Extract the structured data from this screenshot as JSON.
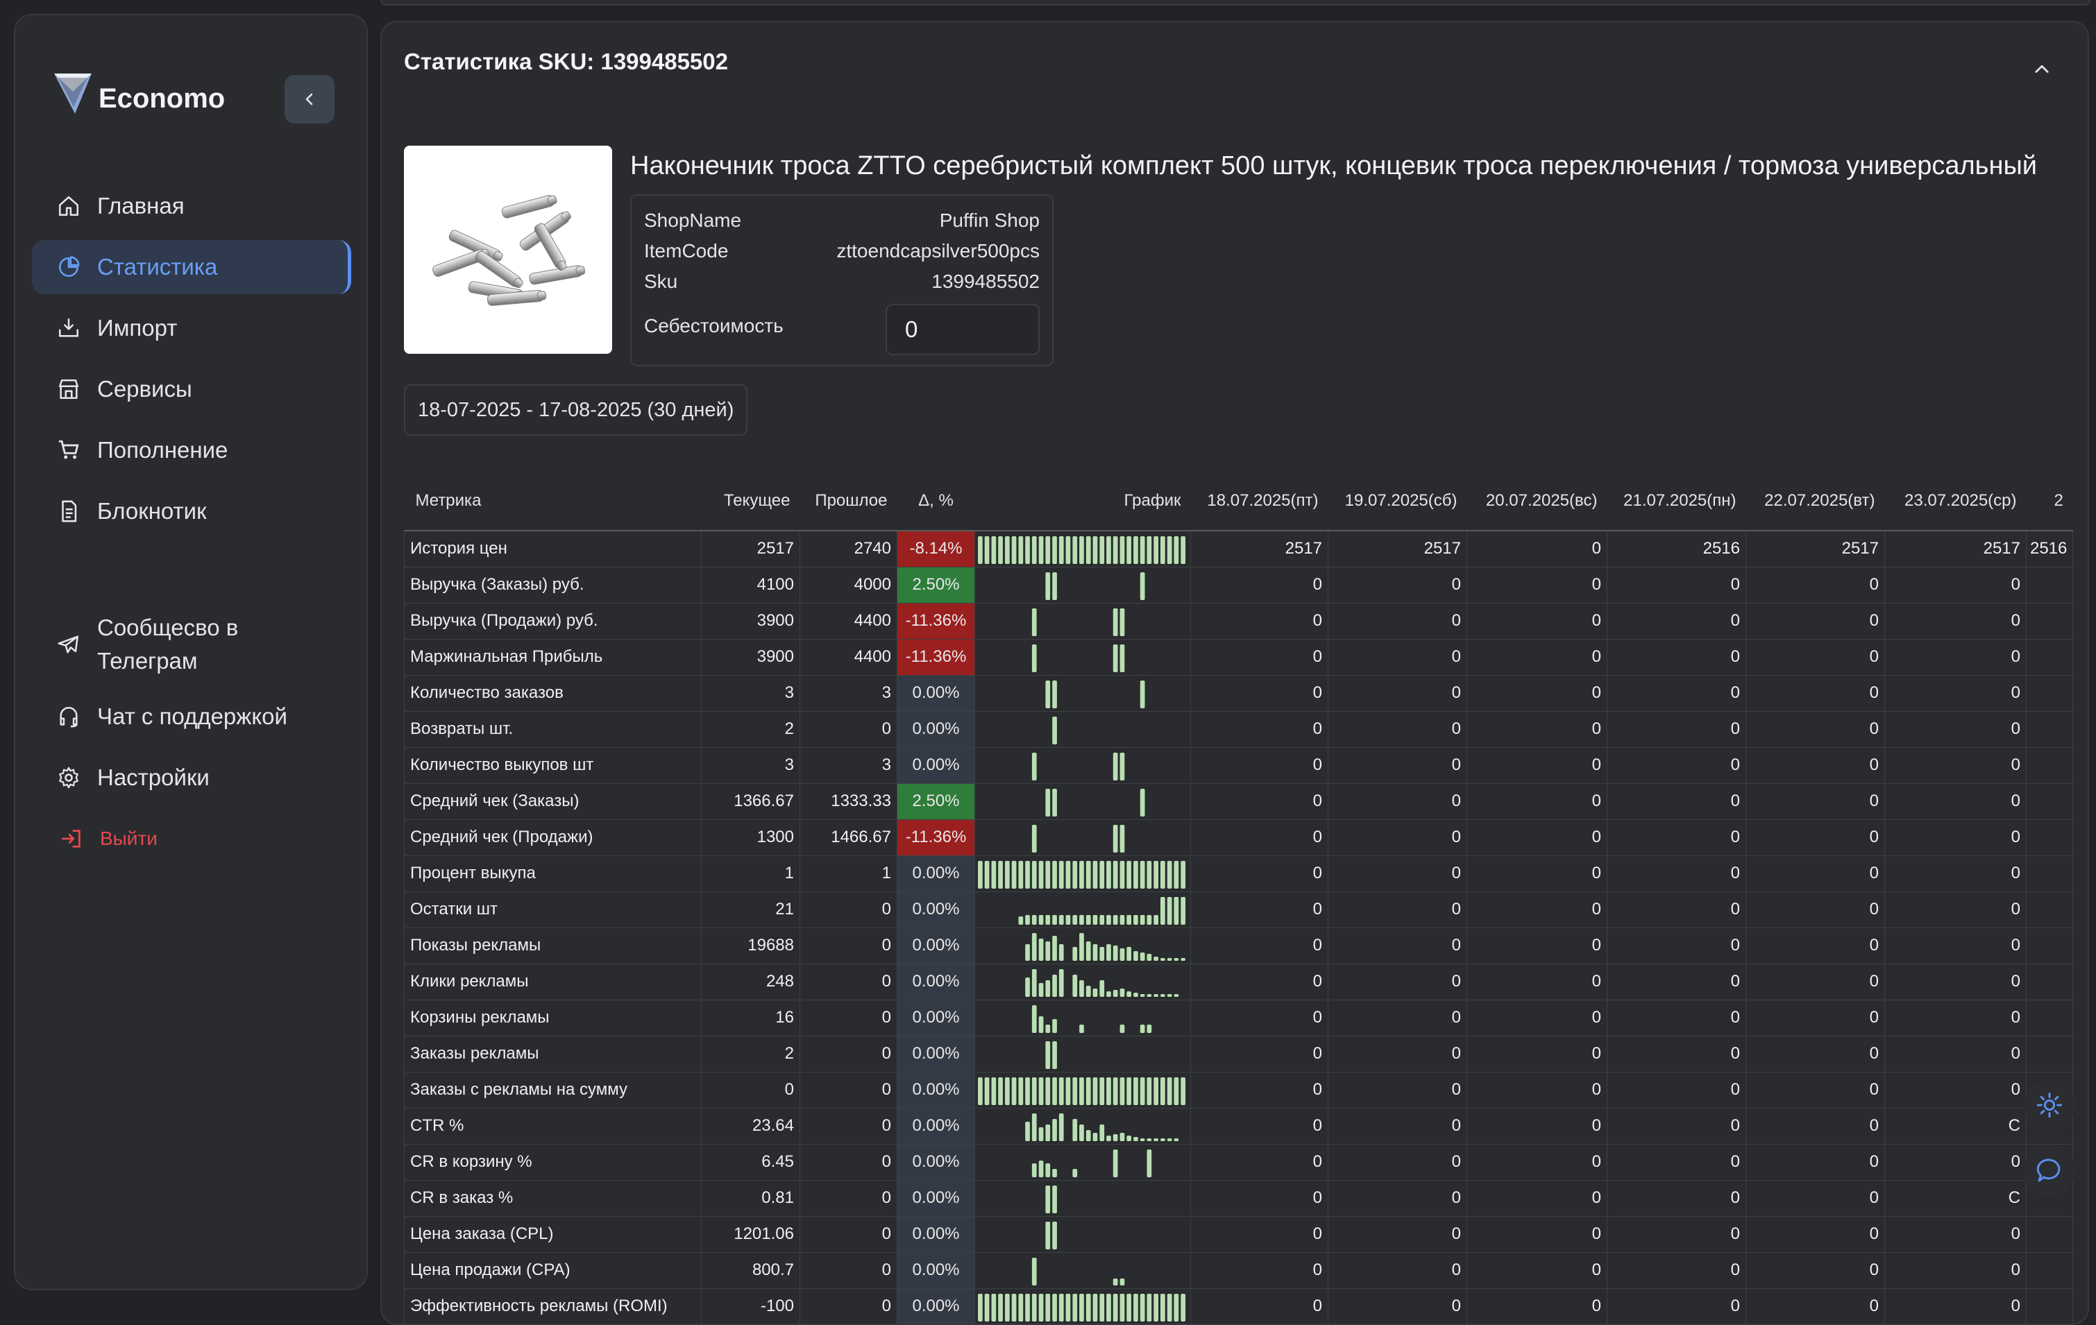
{
  "app": {
    "name": "Economo",
    "collapse_icon": "chevron-left-icon"
  },
  "sidebar": {
    "items": [
      {
        "label": "Главная",
        "icon": "home-icon",
        "active": false
      },
      {
        "label": "Статистика",
        "icon": "pie-chart-icon",
        "active": true
      },
      {
        "label": "Импорт",
        "icon": "import-icon",
        "active": false
      },
      {
        "label": "Сервисы",
        "icon": "store-icon",
        "active": false
      },
      {
        "label": "Пополнение",
        "icon": "cart-icon",
        "active": false
      },
      {
        "label": "Блокнотик",
        "icon": "notebook-icon",
        "active": false
      }
    ],
    "secondary": [
      {
        "label": "Сообщесво в Телеграм",
        "icon": "telegram-icon"
      },
      {
        "label": "Чат с поддержкой",
        "icon": "headset-icon"
      },
      {
        "label": "Настройки",
        "icon": "gear-icon"
      }
    ],
    "logout_label": "Выйти",
    "colors": {
      "active": "#5b8ef0",
      "logout": "#e5484d"
    }
  },
  "panel": {
    "title": "Статистика SKU: 1399485502",
    "product_title": "Наконечник троса ZTTO серебристый комплект 500 штук, концевик троса переключения / тормоза универсальный",
    "info": [
      {
        "key": "ShopName",
        "value": "Puffin Shop"
      },
      {
        "key": "ItemCode",
        "value": "zttoendcapsilver500pcs"
      },
      {
        "key": "Sku",
        "value": "1399485502"
      }
    ],
    "cost_label": "Себестоимость",
    "cost_value": "0",
    "date_range": "18-07-2025 - 17-08-2025 (30 дней)"
  },
  "table": {
    "headers": {
      "metric": "Метрика",
      "current": "Текущее",
      "previous": "Прошлое",
      "delta": "Δ, %",
      "chart": "График",
      "dates": [
        "18.07.2025(пт)",
        "19.07.2025(сб)",
        "20.07.2025(вс)",
        "21.07.2025(пн)",
        "22.07.2025(вт)",
        "23.07.2025(ср)",
        "2"
      ]
    },
    "rows": [
      {
        "metric": "История цен",
        "current": "2517",
        "previous": "2740",
        "delta": "-8.14%",
        "tone": "neg",
        "spark": "full",
        "days": [
          "2517",
          "2517",
          "0",
          "2516",
          "2517",
          "2517",
          "2516"
        ]
      },
      {
        "metric": "Выручка (Заказы) руб.",
        "current": "4100",
        "previous": "4000",
        "delta": "2.50%",
        "tone": "pos",
        "spark": "a",
        "days": [
          "0",
          "0",
          "0",
          "0",
          "0",
          "0",
          ""
        ]
      },
      {
        "metric": "Выручка (Продажи) руб.",
        "current": "3900",
        "previous": "4400",
        "delta": "-11.36%",
        "tone": "neg",
        "spark": "b",
        "days": [
          "0",
          "0",
          "0",
          "0",
          "0",
          "0",
          ""
        ]
      },
      {
        "metric": "Маржинальная Прибыль",
        "current": "3900",
        "previous": "4400",
        "delta": "-11.36%",
        "tone": "neg",
        "spark": "b",
        "days": [
          "0",
          "0",
          "0",
          "0",
          "0",
          "0",
          ""
        ]
      },
      {
        "metric": "Количество заказов",
        "current": "3",
        "previous": "3",
        "delta": "0.00%",
        "tone": "neutral",
        "spark": "a",
        "days": [
          "0",
          "0",
          "0",
          "0",
          "0",
          "0",
          ""
        ]
      },
      {
        "metric": "Возвраты шт.",
        "current": "2",
        "previous": "0",
        "delta": "0.00%",
        "tone": "neutral",
        "spark": "c",
        "days": [
          "0",
          "0",
          "0",
          "0",
          "0",
          "0",
          ""
        ]
      },
      {
        "metric": "Количество выкупов шт",
        "current": "3",
        "previous": "3",
        "delta": "0.00%",
        "tone": "neutral",
        "spark": "b",
        "days": [
          "0",
          "0",
          "0",
          "0",
          "0",
          "0",
          ""
        ]
      },
      {
        "metric": "Средний чек (Заказы)",
        "current": "1366.67",
        "previous": "1333.33",
        "delta": "2.50%",
        "tone": "pos",
        "spark": "a",
        "days": [
          "0",
          "0",
          "0",
          "0",
          "0",
          "0",
          ""
        ]
      },
      {
        "metric": "Средний чек (Продажи)",
        "current": "1300",
        "previous": "1466.67",
        "delta": "-11.36%",
        "tone": "neg",
        "spark": "b",
        "days": [
          "0",
          "0",
          "0",
          "0",
          "0",
          "0",
          ""
        ]
      },
      {
        "metric": "Процент выкупа",
        "current": "1",
        "previous": "1",
        "delta": "0.00%",
        "tone": "neutral",
        "spark": "full",
        "days": [
          "0",
          "0",
          "0",
          "0",
          "0",
          "0",
          ""
        ]
      },
      {
        "metric": "Остатки шт",
        "current": "21",
        "previous": "0",
        "delta": "0.00%",
        "tone": "neutral",
        "spark": "stock",
        "days": [
          "0",
          "0",
          "0",
          "0",
          "0",
          "0",
          ""
        ]
      },
      {
        "metric": "Показы рекламы",
        "current": "19688",
        "previous": "0",
        "delta": "0.00%",
        "tone": "neutral",
        "spark": "ads",
        "days": [
          "0",
          "0",
          "0",
          "0",
          "0",
          "0",
          ""
        ]
      },
      {
        "metric": "Клики рекламы",
        "current": "248",
        "previous": "0",
        "delta": "0.00%",
        "tone": "neutral",
        "spark": "ads2",
        "days": [
          "0",
          "0",
          "0",
          "0",
          "0",
          "0",
          ""
        ]
      },
      {
        "metric": "Корзины рекламы",
        "current": "16",
        "previous": "0",
        "delta": "0.00%",
        "tone": "neutral",
        "spark": "carts",
        "days": [
          "0",
          "0",
          "0",
          "0",
          "0",
          "0",
          ""
        ]
      },
      {
        "metric": "Заказы рекламы",
        "current": "2",
        "previous": "0",
        "delta": "0.00%",
        "tone": "neutral",
        "spark": "d",
        "days": [
          "0",
          "0",
          "0",
          "0",
          "0",
          "0",
          ""
        ]
      },
      {
        "metric": "Заказы с рекламы на сумму",
        "current": "0",
        "previous": "0",
        "delta": "0.00%",
        "tone": "neutral",
        "spark": "full",
        "days": [
          "0",
          "0",
          "0",
          "0",
          "0",
          "0",
          ""
        ]
      },
      {
        "metric": "CTR %",
        "current": "23.64",
        "previous": "0",
        "delta": "0.00%",
        "tone": "neutral",
        "spark": "ads2",
        "days": [
          "0",
          "0",
          "0",
          "0",
          "0",
          "C",
          ""
        ]
      },
      {
        "metric": "CR в корзину %",
        "current": "6.45",
        "previous": "0",
        "delta": "0.00%",
        "tone": "neutral",
        "spark": "cr",
        "days": [
          "0",
          "0",
          "0",
          "0",
          "0",
          "0",
          ""
        ]
      },
      {
        "metric": "CR в заказ %",
        "current": "0.81",
        "previous": "0",
        "delta": "0.00%",
        "tone": "neutral",
        "spark": "d",
        "days": [
          "0",
          "0",
          "0",
          "0",
          "0",
          "C",
          ""
        ]
      },
      {
        "metric": "Цена заказа (CPL)",
        "current": "1201.06",
        "previous": "0",
        "delta": "0.00%",
        "tone": "neutral",
        "spark": "d",
        "days": [
          "0",
          "0",
          "0",
          "0",
          "0",
          "0",
          ""
        ]
      },
      {
        "metric": "Цена продажи (CPA)",
        "current": "800.7",
        "previous": "0",
        "delta": "0.00%",
        "tone": "neutral",
        "spark": "e",
        "days": [
          "0",
          "0",
          "0",
          "0",
          "0",
          "0",
          ""
        ]
      },
      {
        "metric": "Эффективность рекламы (ROMI)",
        "current": "-100",
        "previous": "0",
        "delta": "0.00%",
        "tone": "neutral",
        "spark": "full",
        "days": [
          "0",
          "0",
          "0",
          "0",
          "0",
          "0",
          ""
        ]
      }
    ],
    "colors": {
      "neg": "#9a1f1f",
      "pos": "#2e7d3b",
      "neutral": "#333a45",
      "spark": "#b9dfb3"
    }
  },
  "fabs": [
    {
      "icon": "sun-icon"
    },
    {
      "icon": "chat-bubble-icon"
    }
  ]
}
